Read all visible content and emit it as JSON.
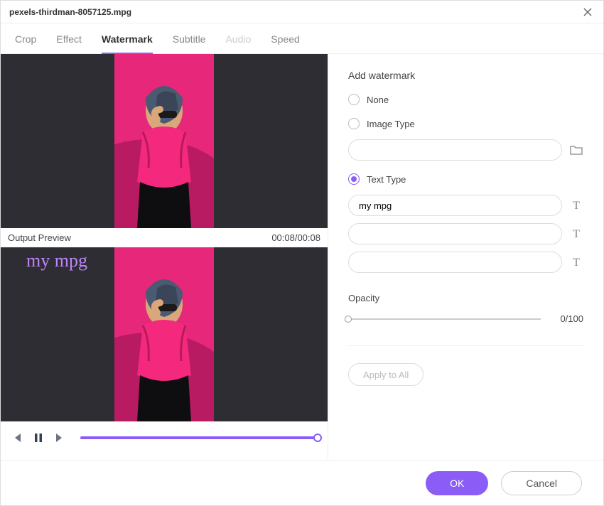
{
  "title": "pexels-thirdman-8057125.mpg",
  "tabs": [
    {
      "label": "Crop",
      "active": false,
      "disabled": false
    },
    {
      "label": "Effect",
      "active": false,
      "disabled": false
    },
    {
      "label": "Watermark",
      "active": true,
      "disabled": false
    },
    {
      "label": "Subtitle",
      "active": false,
      "disabled": false
    },
    {
      "label": "Audio",
      "active": false,
      "disabled": true
    },
    {
      "label": "Speed",
      "active": false,
      "disabled": false
    }
  ],
  "preview": {
    "label": "Output Preview",
    "time": "00:08/00:08",
    "watermark_text": "my mpg"
  },
  "panel": {
    "title": "Add watermark",
    "options": {
      "none": "None",
      "image": "Image Type",
      "text": "Text Type"
    },
    "selected": "text",
    "image_path": "",
    "text_lines": [
      "my mpg",
      "",
      ""
    ],
    "opacity": {
      "label": "Opacity",
      "value": 0,
      "display": "0/100"
    },
    "apply_all": "Apply to All"
  },
  "footer": {
    "ok": "OK",
    "cancel": "Cancel"
  }
}
